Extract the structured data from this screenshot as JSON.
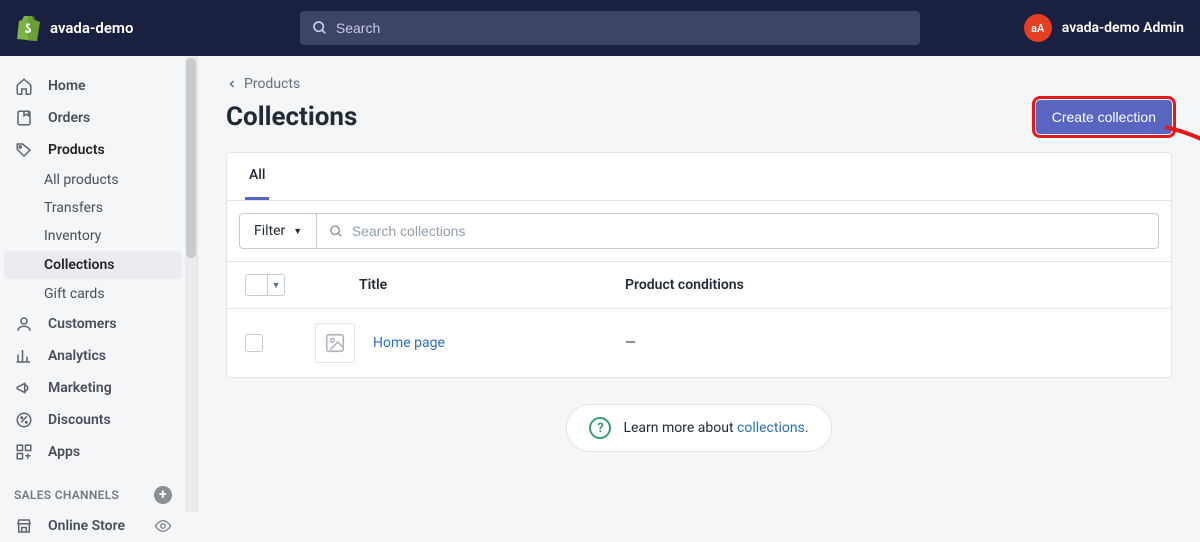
{
  "header": {
    "store_name": "avada-demo",
    "search_placeholder": "Search",
    "avatar_initials": "aA",
    "user_name": "avada-demo Admin"
  },
  "sidebar": {
    "items": [
      {
        "label": "Home"
      },
      {
        "label": "Orders"
      },
      {
        "label": "Products"
      },
      {
        "label": "Customers"
      },
      {
        "label": "Analytics"
      },
      {
        "label": "Marketing"
      },
      {
        "label": "Discounts"
      },
      {
        "label": "Apps"
      }
    ],
    "products_sub": [
      {
        "label": "All products"
      },
      {
        "label": "Transfers"
      },
      {
        "label": "Inventory"
      },
      {
        "label": "Collections"
      },
      {
        "label": "Gift cards"
      }
    ],
    "channels_header": "SALES CHANNELS",
    "channels": [
      {
        "label": "Online Store"
      }
    ]
  },
  "breadcrumb": {
    "back_label": "Products"
  },
  "page": {
    "title": "Collections",
    "create_button": "Create collection"
  },
  "tabs": [
    {
      "label": "All",
      "active": true
    }
  ],
  "toolbar": {
    "filter_label": "Filter",
    "search_placeholder": "Search collections"
  },
  "table": {
    "columns": {
      "title": "Title",
      "conditions": "Product conditions"
    },
    "rows": [
      {
        "title": "Home page",
        "conditions": "—"
      }
    ]
  },
  "learn_more": {
    "prefix": "Learn more about ",
    "link_text": "collections",
    "suffix": "."
  },
  "colors": {
    "accent": "#5865c1",
    "annotation": "#e11b1b"
  }
}
